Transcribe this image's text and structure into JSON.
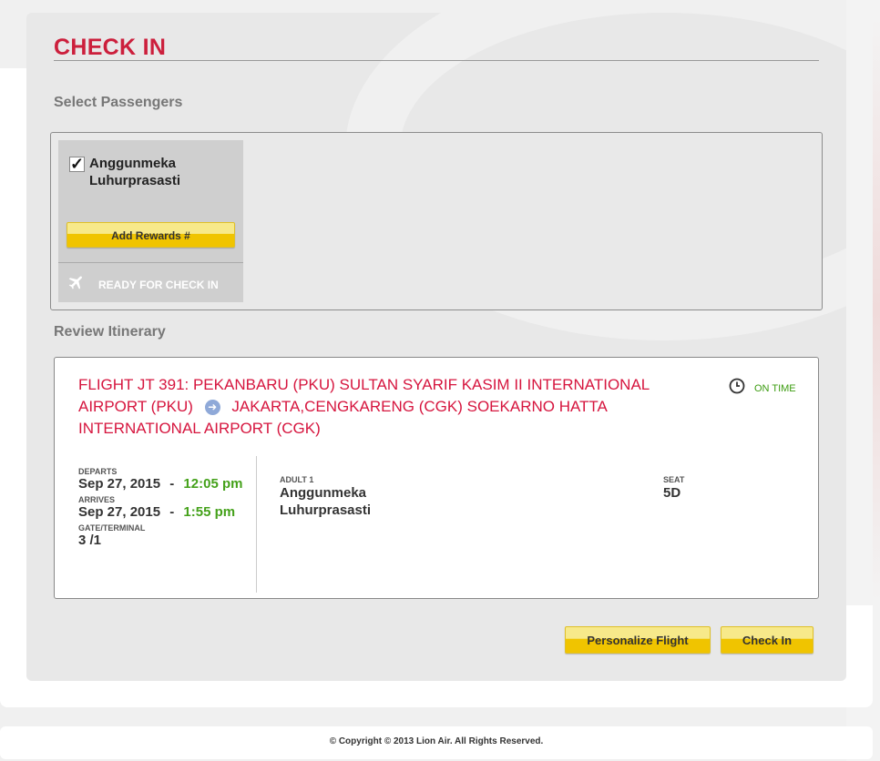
{
  "page": {
    "title": "CHECK IN",
    "select_passengers_label": "Select Passengers",
    "review_itinerary_label": "Review Itinerary"
  },
  "passengers": [
    {
      "name_line1": "Anggunmeka",
      "name_line2": "Luhurprasasti",
      "checked": true,
      "rewards_button": "Add Rewards #",
      "status": "READY FOR CHECK IN"
    }
  ],
  "itinerary": {
    "flight_prefix": "FLIGHT JT 391:  PEKANBARU (PKU) SULTAN SYARIF KASIM II INTERNATIONAL AIRPORT (PKU)",
    "flight_suffix": "JAKARTA,CENGKARENG (CGK) SOEKARNO HATTA INTERNATIONAL AIRPORT (CGK)",
    "status": "ON TIME",
    "departs_label": "DEPARTS",
    "departs_date": "Sep 27, 2015",
    "departs_time": "12:05 pm",
    "arrives_label": "ARRIVES",
    "arrives_date": "Sep 27, 2015",
    "arrives_time": "1:55 pm",
    "separator": "-",
    "gate_label": "GATE/TERMINAL",
    "gate_value": "3 /1",
    "adult_label": "ADULT 1",
    "adult_name_line1": "Anggunmeka",
    "adult_name_line2": "Luhurprasasti",
    "seat_label": "SEAT",
    "seat_value": "5D"
  },
  "actions": {
    "personalize": "Personalize Flight",
    "check_in": "Check In"
  },
  "footer": {
    "copyright": "© Copyright © 2013 Lion Air. All Rights Reserved."
  },
  "colors": {
    "brand_red": "#cc1f3c",
    "on_time_green": "#3a9b0e",
    "button_yellow": "#f0c400"
  }
}
